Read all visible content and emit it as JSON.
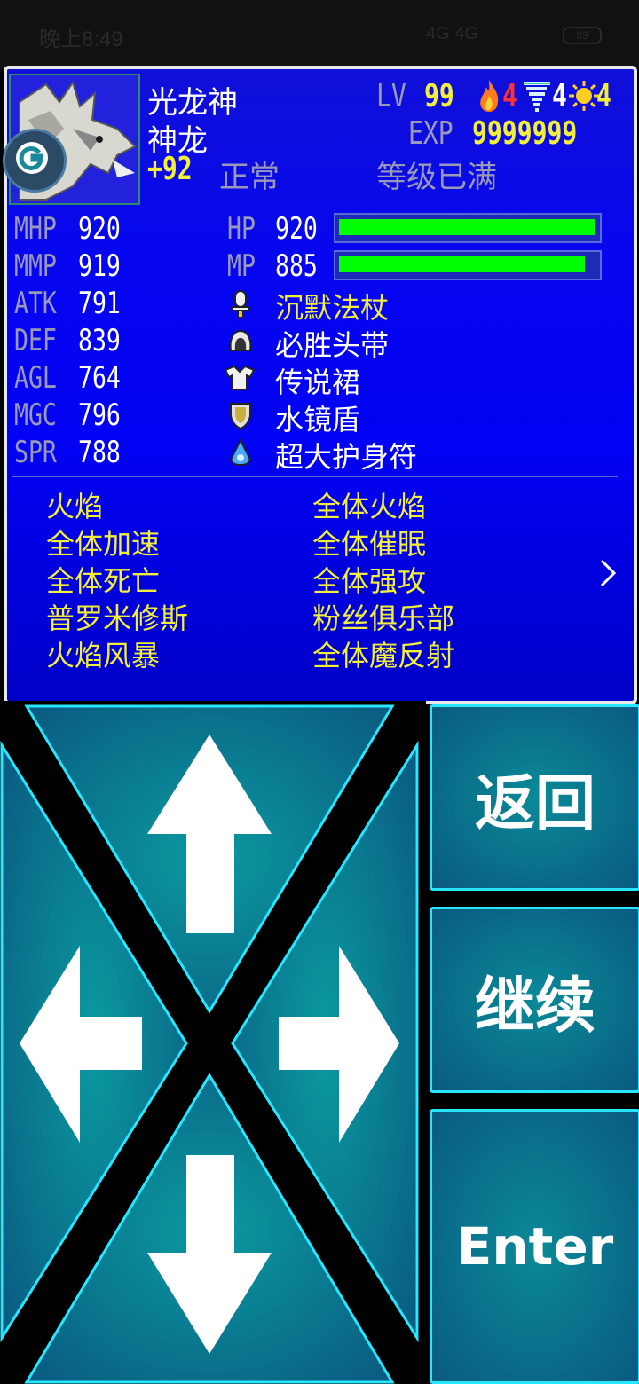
{
  "status_bar": {
    "time": "晚上8:49",
    "network": "4G 4G",
    "battery": "89"
  },
  "character": {
    "name": "光龙神",
    "class": "神龙",
    "bonus": "+92",
    "state": "正常",
    "level_label": "LV",
    "level": "99",
    "exp_label": "EXP",
    "exp": "9999999",
    "exp_status": "等级已满",
    "elements": [
      {
        "icon": "fire-icon",
        "count": "4",
        "color": "#ff3030"
      },
      {
        "icon": "wind-icon",
        "count": "4",
        "color": "#ffffff"
      },
      {
        "icon": "sun-icon",
        "count": "4",
        "color": "#f2ef3a"
      }
    ]
  },
  "stats": [
    {
      "label": "MHP",
      "value": "920"
    },
    {
      "label": "MMP",
      "value": "919"
    },
    {
      "label": "ATK",
      "value": "791"
    },
    {
      "label": "DEF",
      "value": "839"
    },
    {
      "label": "AGL",
      "value": "764"
    },
    {
      "label": "MGC",
      "value": "796"
    },
    {
      "label": "SPR",
      "value": "788"
    }
  ],
  "hp": {
    "label": "HP",
    "value": "920",
    "fraction": 1.0
  },
  "mp": {
    "label": "MP",
    "value": "885",
    "fraction": 0.962
  },
  "equipment": [
    {
      "icon": "staff-icon",
      "name": "沉默法杖"
    },
    {
      "icon": "helmet-icon",
      "name": "必胜头带"
    },
    {
      "icon": "armor-icon",
      "name": "传说裙"
    },
    {
      "icon": "shield-icon",
      "name": "水镜盾"
    },
    {
      "icon": "amulet-icon",
      "name": "超大护身符"
    }
  ],
  "skills_left": [
    "火焰",
    "全体加速",
    "全体死亡",
    "普罗米修斯",
    "火焰风暴"
  ],
  "skills_right": [
    "全体火焰",
    "全体催眠",
    "全体强攻",
    "粉丝俱乐部",
    "全体魔反射"
  ],
  "controls": {
    "back": "返回",
    "continue": "继续",
    "enter": "Enter"
  },
  "colors": {
    "accent": "#27e6ff",
    "gauge": "#00ff00",
    "text_yellow": "#f2ef3a"
  }
}
